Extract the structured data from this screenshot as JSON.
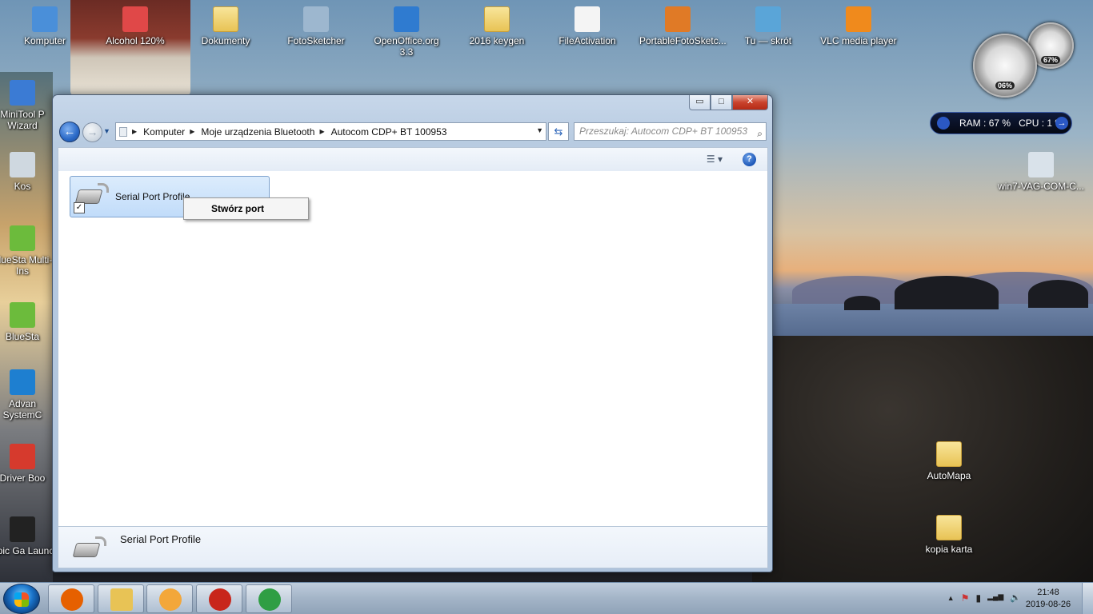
{
  "desktop": {
    "top_icons": [
      {
        "label": "Komputer",
        "icon": "computer-icon",
        "color": "#4a8fd9"
      },
      {
        "label": "Alcohol 120%",
        "icon": "alcohol-icon",
        "color": "#e04848"
      },
      {
        "label": "Dokumenty",
        "icon": "folder-icon",
        "color": "#e8c355"
      },
      {
        "label": "FotoSketcher",
        "icon": "fotosketcher-icon",
        "color": "#9db7cf"
      },
      {
        "label": "OpenOffice.org 3.3",
        "icon": "openoffice-icon",
        "color": "#2f7bd0"
      },
      {
        "label": "2016 keygen",
        "icon": "folder-icon",
        "color": "#e8c355"
      },
      {
        "label": "FileActivation",
        "icon": "document-icon",
        "color": "#f4f4f4"
      },
      {
        "label": "PortableFotoSketc...",
        "icon": "portable-fotosketcher-icon",
        "color": "#e07a26"
      },
      {
        "label": "Tu — skrót",
        "icon": "shortcut-icon",
        "color": "#5aa5d8"
      },
      {
        "label": "VLC media player",
        "icon": "vlc-icon",
        "color": "#f08a1c"
      }
    ],
    "left_icons": [
      {
        "label": "MiniTool P Wizard",
        "icon": "minitool-icon",
        "color": "#3b7bd4"
      },
      {
        "label": "Kos",
        "icon": "recycle-bin-icon",
        "color": "#cfd8e0"
      },
      {
        "label": "BlueSta Multi-Ins",
        "icon": "bluestacks-icon",
        "color": "#6cbb3c"
      },
      {
        "label": "BlueSta",
        "icon": "bluestacks-icon",
        "color": "#6cbb3c"
      },
      {
        "label": "Advan SystemC",
        "icon": "advanced-systemcare-icon",
        "color": "#1e7fd0"
      },
      {
        "label": "Driver Boo",
        "icon": "driver-booster-icon",
        "color": "#d63a2d"
      },
      {
        "label": "Epic Ga Launc",
        "icon": "epic-games-icon",
        "color": "#222222"
      }
    ],
    "right_icons": [
      {
        "label": "win7-VAG-COM-C...",
        "icon": "settings-shortcut-icon",
        "color": "#d9e2ea"
      },
      {
        "label": "AutoMapa",
        "icon": "folder-icon",
        "color": "#e8c355"
      },
      {
        "label": "kopia karta",
        "icon": "folder-icon",
        "color": "#e8c355"
      }
    ]
  },
  "gadgets": {
    "gauge_left_value": "06%",
    "gauge_right_value": "67%",
    "ram_label": "RAM :",
    "ram_value": "67 %",
    "cpu_label": "CPU :",
    "cpu_value": "1 %"
  },
  "window": {
    "controls": {
      "minimize": "▭",
      "maximize": "□",
      "close": "✕"
    },
    "breadcrumbs": [
      "Komputer",
      "Moje urządzenia Bluetooth",
      "Autocom CDP+ BT 100953"
    ],
    "search_placeholder": "Przeszukaj: Autocom CDP+ BT 100953",
    "help_label": "?",
    "item_label": "Serial Port Profile",
    "item_checked_glyph": "✓",
    "context_menu_item": "Stwórz port",
    "details_label": "Serial Port Profile"
  },
  "taskbar": {
    "apps": [
      {
        "name": "firefox",
        "color": "#e66000"
      },
      {
        "name": "file-explorer",
        "color": "#e8c355"
      },
      {
        "name": "media-player",
        "color": "#f3a73a"
      },
      {
        "name": "driver-booster",
        "color": "#c8261b"
      },
      {
        "name": "chrome",
        "color": "#2f9e44"
      }
    ],
    "tray_icons": [
      "▲",
      "⚑",
      "▮",
      "▂▄▆",
      "🔊"
    ],
    "time": "21:48",
    "date": "2019-08-26"
  }
}
